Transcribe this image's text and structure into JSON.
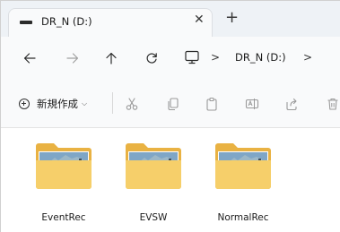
{
  "tab": {
    "title": "DR_N (D:)",
    "close_glyph": "✕",
    "new_tab_glyph": "+",
    "icon": "drive-icon"
  },
  "nav": {
    "back_icon": "arrow-left-icon",
    "forward_icon": "arrow-right-icon",
    "up_icon": "arrow-up-icon",
    "refresh_icon": "refresh-icon",
    "address": {
      "root_icon": "pc-icon",
      "separator": ">",
      "crumb": "DR_N (D:)",
      "trailing_separator": ">"
    }
  },
  "commandbar": {
    "new_label": "新規作成",
    "new_chevron": "⌵",
    "icons": [
      "cut-icon",
      "copy-icon",
      "paste-icon",
      "rename-icon",
      "share-icon",
      "delete-icon"
    ]
  },
  "folders": [
    {
      "name": "EventRec"
    },
    {
      "name": "EVSW"
    },
    {
      "name": "NormalRec"
    }
  ],
  "colors": {
    "folder_back": "#e9b243",
    "folder_front": "#f6cf6a",
    "tabstrip_bg": "#eef2f6",
    "toolbar_bg": "#f9fafb"
  }
}
